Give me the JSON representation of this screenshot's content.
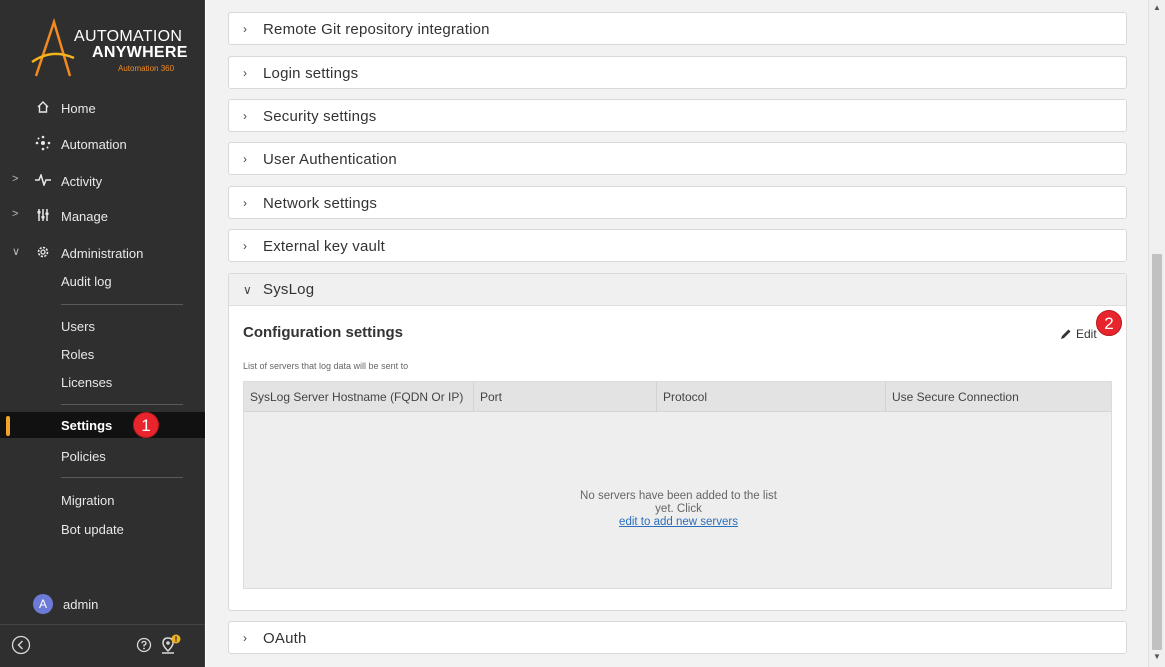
{
  "logo": {
    "line1": "AUTOMATION",
    "line2": "ANYWHERE",
    "line3": "Automation 360"
  },
  "sidebar": {
    "nav": [
      {
        "label": "Home",
        "icon": "home-icon"
      },
      {
        "label": "Automation",
        "icon": "automation-icon"
      },
      {
        "label": "Activity",
        "icon": "activity-icon",
        "chevron": ">"
      },
      {
        "label": "Manage",
        "icon": "manage-icon",
        "chevron": ">"
      },
      {
        "label": "Administration",
        "icon": "gear-icon",
        "chevron": "∨"
      }
    ],
    "admin_items": [
      {
        "label": "Audit log"
      },
      {
        "label": "Users"
      },
      {
        "label": "Roles"
      },
      {
        "label": "Licenses"
      },
      {
        "label": "Settings",
        "active": true
      },
      {
        "label": "Policies"
      },
      {
        "label": "Migration"
      },
      {
        "label": "Bot update"
      }
    ],
    "user": {
      "initial": "A",
      "name": "admin"
    },
    "bottom_icons": [
      "collapse-icon",
      "help-icon",
      "location-alert-icon"
    ]
  },
  "callouts": {
    "one": "1",
    "two": "2"
  },
  "panels": [
    {
      "title": "Remote Git repository integration",
      "chevron": "›"
    },
    {
      "title": "Login settings",
      "chevron": "›"
    },
    {
      "title": "Security settings",
      "chevron": "›"
    },
    {
      "title": "User Authentication",
      "chevron": "›"
    },
    {
      "title": "Network settings",
      "chevron": "›"
    },
    {
      "title": "External key vault",
      "chevron": "›"
    }
  ],
  "syslog": {
    "title": "SysLog",
    "chevron": "∨",
    "config_title": "Configuration settings",
    "edit_label": "Edit",
    "subtitle": "List of servers that log data will be sent to",
    "columns": [
      "SysLog Server Hostname (FQDN Or IP)",
      "Port",
      "Protocol",
      "Use Secure Connection"
    ],
    "empty_line1": "No servers have been added to the list",
    "empty_line2": "yet. Click",
    "empty_link": "edit to add new servers"
  },
  "oauth": {
    "title": "OAuth",
    "chevron": "›"
  },
  "colors": {
    "sidebar_bg": "#2f2f2f",
    "accent": "#f2a32a",
    "callout": "#e8252c",
    "link": "#2a6ebb"
  }
}
